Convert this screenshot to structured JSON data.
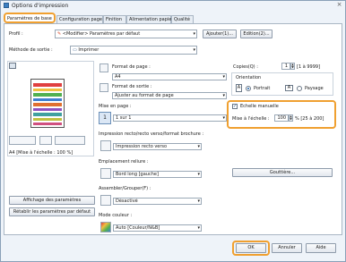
{
  "window": {
    "title": "Options d'impression",
    "close_label": "×"
  },
  "tabs": [
    {
      "label": "Paramètres de base"
    },
    {
      "label": "Configuration page"
    },
    {
      "label": "Finition"
    },
    {
      "label": "Alimentation papier"
    },
    {
      "label": "Qualité"
    }
  ],
  "profile": {
    "label": "Profil :",
    "value": "<Modifier> Paramètres par défaut",
    "add_button": "Ajouter(1)...",
    "edit_button": "Edition(2)..."
  },
  "output": {
    "label": "Méthode de sortie :",
    "value": "Imprimer"
  },
  "preview": {
    "caption": "A4 [Mise à l'échelle : 100 %]"
  },
  "left_buttons": {
    "show_settings": "Affichage des paramètres",
    "restore_defaults": "Rétablir les paramètres par défaut"
  },
  "page_format": {
    "label": "Format de page :",
    "value": "A4"
  },
  "output_format": {
    "label": "Format de sortie :",
    "value": "Ajuster au format de page"
  },
  "copies": {
    "label": "Copies(Q) :",
    "value": "1",
    "range": "[1 à 9999]"
  },
  "orientation": {
    "label": "Orientation",
    "portrait": "Portrait",
    "landscape": "Paysage",
    "selected": "portrait"
  },
  "layout": {
    "label": "Mise en page :",
    "value": "1 sur 1"
  },
  "manual_scale": {
    "checkbox_label": "Echelle manuelle",
    "checked": true,
    "scale_label": "Mise à l'échelle :",
    "value": "100",
    "range": "% [25 à 200]"
  },
  "duplex": {
    "label": "Impression recto/recto verso/format brochure :",
    "value": "Impression recto verso"
  },
  "binding": {
    "label": "Emplacement reliure :",
    "value": "Bord long [gauche]",
    "gutter_button": "Gouttière..."
  },
  "collate": {
    "label": "Assembler/Grouper(F) :",
    "value": "Désactivé"
  },
  "color_mode": {
    "label": "Mode couleur :",
    "value": "Auto [Couleur/N&B]"
  },
  "footer": {
    "ok": "OK",
    "cancel": "Annuler",
    "help": "Aide"
  }
}
